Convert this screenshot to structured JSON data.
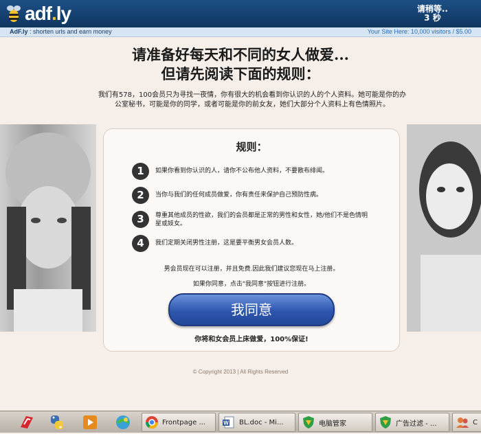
{
  "adfly": {
    "logo": "adf.ly",
    "wait_line1": "请稍等..",
    "wait_line2": "3 秒",
    "tagline_brand": "AdF.ly",
    "tagline_rest": " : shorten urls and earn money",
    "site_ad": "Your Site Here: 10,000 visitors / $5.00"
  },
  "page": {
    "headline1": "请准备好每天和不同的女人做爱...",
    "headline2": "但请先阅读下面的规则：",
    "intro": "我们有578，100会员只为寻找一夜情，你有很大的机会看到你认识的人的个人资料。她可能是你的办公室秘书，可能是你的同学，或者可能是你的前女友，她们大部分个人资料上有色情照片。",
    "rules_title": "规则：",
    "rules": [
      {
        "num": "1",
        "text": "如果你看到你认识的人，请你不公布他人资料，不要散布绯闻。"
      },
      {
        "num": "2",
        "text": "当你与我们的任何成员做爱，你有责任来保护自己预防性病。"
      },
      {
        "num": "3",
        "text": "尊重其他成员的性欲，我们的会员都是正常的男性和女性，她/他们不是色情明星或妓女。"
      },
      {
        "num": "4",
        "text": "我们定期关闭男性注册，这是要平衡男女会员人数。"
      }
    ],
    "note1": "男会员现在可以注册，并且免费.因此我们建议您现在马上注册。",
    "note2": "如果你同意，点击\"我同意\"按钮进行注册。",
    "agree_button": "我同意",
    "guarantee": "你将和女会员上床做爱，100%保证!",
    "copyright": "© Copyright 2013 | All Rights Reserved"
  },
  "taskbar": {
    "tasks": [
      {
        "icon": "chrome-icon",
        "label": "Frontpage ..."
      },
      {
        "icon": "word-doc-icon",
        "label": "BL.doc - Mi..."
      },
      {
        "icon": "shield-icon",
        "label": "电脑管家"
      },
      {
        "icon": "shield-icon",
        "label": "广告过滤 - ..."
      },
      {
        "icon": "people-icon",
        "label": "C"
      }
    ]
  },
  "colors": {
    "adfly_bar": "#16436f",
    "agree_button": "#2d56ad",
    "page_bg": "#f6efe9"
  }
}
